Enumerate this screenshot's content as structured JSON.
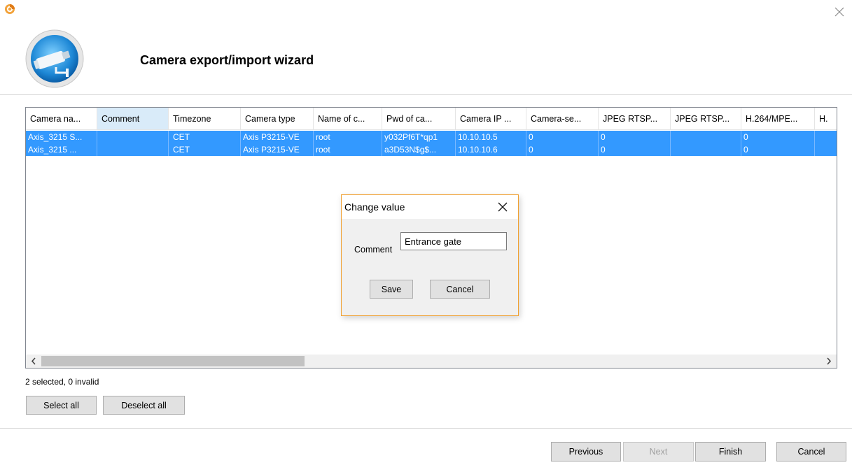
{
  "window": {
    "title": "Camera export/import wizard",
    "icon": "app-logo-icon",
    "close_icon": "close-icon",
    "logo_icon": "camera-logo-icon"
  },
  "table": {
    "columns": [
      "Camera na...",
      "Comment",
      "Timezone",
      "Camera type",
      "Name of c...",
      "Pwd of ca...",
      "Camera IP ...",
      "Camera-se...",
      "JPEG RTSP...",
      "JPEG RTSP...",
      "H.264/MPE...",
      "H."
    ],
    "selected_column": "Comment",
    "rows": [
      [
        "Axis_3215 S...",
        "",
        "CET",
        "Axis P3215-VE",
        "root",
        "y032Pf6T*qp1",
        "10.10.10.5",
        "0",
        "0",
        "",
        "0",
        ""
      ],
      [
        "Axis_3215 ...",
        "",
        "CET",
        "Axis P3215-VE",
        "root",
        "a3D53N$g$...",
        "10.10.10.6",
        "0",
        "0",
        "",
        "0",
        ""
      ]
    ],
    "scroll_left_icon": "chevron-left-icon",
    "scroll_right_icon": "chevron-right-icon"
  },
  "status": "2 selected, 0 invalid",
  "buttons": {
    "select_all": "Select all",
    "deselect_all": "Deselect all",
    "previous": "Previous",
    "next": "Next",
    "finish": "Finish",
    "cancel": "Cancel"
  },
  "dialog": {
    "title": "Change value",
    "label": "Comment",
    "value": "Entrance gate",
    "save": "Save",
    "cancel": "Cancel"
  },
  "colors": {
    "selection": "#3399ff",
    "dialog_border": "#f0a030",
    "header_highlight": "#d9ebf9"
  }
}
